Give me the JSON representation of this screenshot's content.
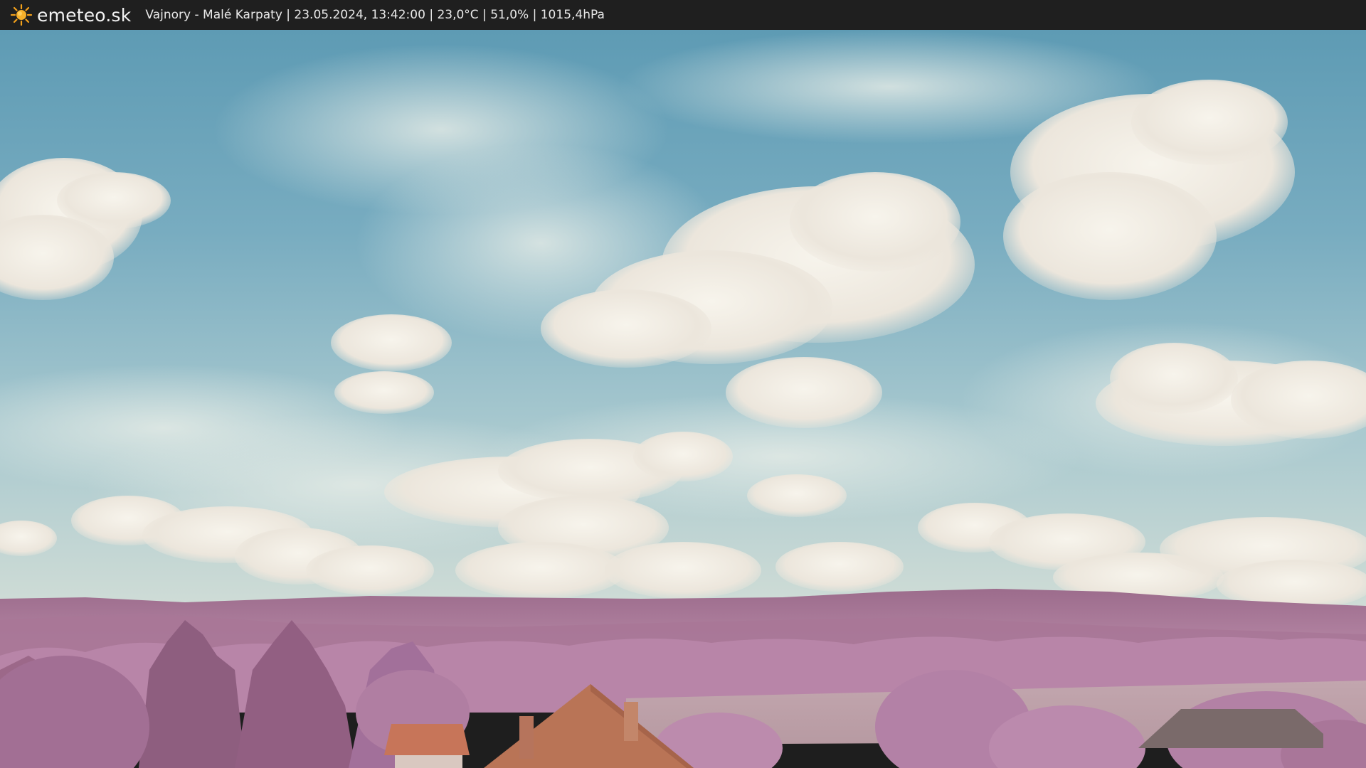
{
  "header": {
    "logo_icon": "sun-icon",
    "brand": "emeteo.sk",
    "info": "Vajnory - Malé Karpaty | 23.05.2024, 13:42:00 | 23,0°C | 51,0% | 1015,4hPa"
  },
  "colors": {
    "bar": "#1f1f1f",
    "sun": "#f4a11a",
    "sky": "#5f9fb7",
    "foliage": "#b57ea4",
    "roof": "#c7745a"
  }
}
